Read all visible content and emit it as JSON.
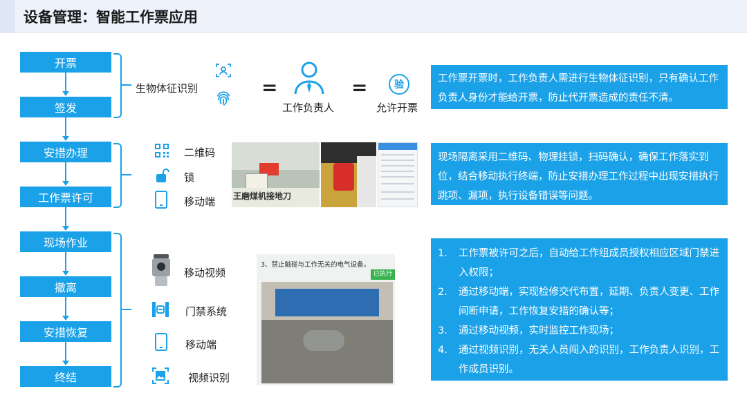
{
  "title": "设备管理：智能工作票应用",
  "flow_steps": [
    "开票",
    "签发",
    "安措办理",
    "工作票许可",
    "现场作业",
    "撤离",
    "安措恢复",
    "终结"
  ],
  "group1": {
    "label": "生物体征识别",
    "equals": "=",
    "person_label": "工作负责人",
    "permit_label": "允许开票",
    "stamp_char": "验",
    "description": "工作票开票时，工作负责人需进行生物体征识别，只有确认工作负责人身份才能给开票，防止代开票造成的责任不清。"
  },
  "group2": {
    "items": [
      "二维码",
      "锁",
      "移动端"
    ],
    "description": "现场隔离采用二维码、物理挂锁，扫码确认，确保工作落实到位，结合移动执行终端，防止安措办理工作过程中出现安措执行跳项、漏项，执行设备错误等问题。",
    "photo_text": "王磨煤机接地刀"
  },
  "group3": {
    "items": [
      "移动视频",
      "门禁系统",
      "移动端",
      "视频识别"
    ],
    "photo_caption": "3、禁止触碰与工作无关的电气设备。",
    "photo_badge": "已执行",
    "points": [
      {
        "num": "1.",
        "text": "工作票被许可之后，自动给工作组成员授权相应区域门禁进入权限；"
      },
      {
        "num": "2.",
        "text": "通过移动端，实现检修交代布置，延期、负责人变更、工作间断申请，工作恢复安措的确认等；"
      },
      {
        "num": "3.",
        "text": "通过移动视频，实时监控工作现场；"
      },
      {
        "num": "4.",
        "text": "通过视频识别，无关人员闯入的识别，工作负责人识别，工作成员识别。"
      }
    ]
  },
  "colors": {
    "accent": "#1aa1e8",
    "title_bg": "#eef3fb"
  }
}
